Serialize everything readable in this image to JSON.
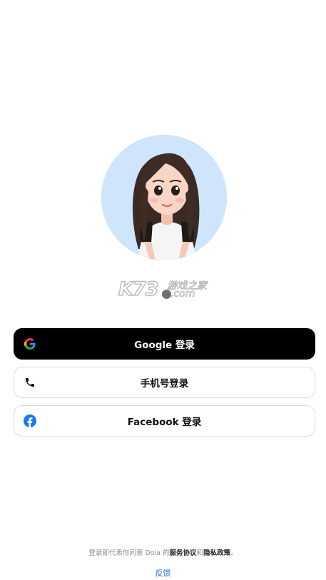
{
  "colors": {
    "primary_button_bg": "#000000",
    "secondary_border": "#dcdcdc",
    "link_blue": "#2f6bdf",
    "avatar_bg": "#cfe5fb",
    "facebook_blue": "#1877f2"
  },
  "avatar": {
    "icon": "cartoon-girl-avatar"
  },
  "watermark": {
    "main": "K73",
    "cn": "游戏之家",
    "com": ".com"
  },
  "buttons": {
    "google": {
      "label": "Google 登录",
      "icon": "google-icon"
    },
    "phone": {
      "label": "手机号登录",
      "icon": "phone-icon"
    },
    "facebook": {
      "label": "Facebook 登录",
      "icon": "facebook-icon"
    }
  },
  "footer": {
    "terms_prefix": "登录即代表你同意 Dola 的",
    "terms_link": "服务协议",
    "terms_and": "和",
    "privacy_link": "隐私政策",
    "terms_suffix": "。",
    "feedback": "反馈"
  }
}
